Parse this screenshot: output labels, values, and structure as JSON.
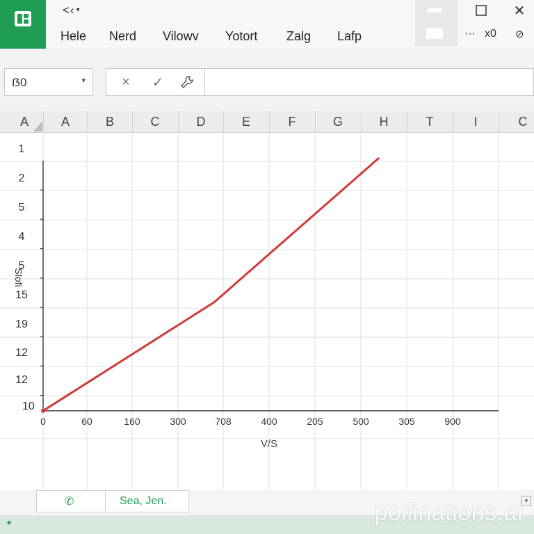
{
  "app": {
    "brand_color": "#1f9d55"
  },
  "quick_access": {
    "text": "<‹",
    "dropdown": "▾"
  },
  "menu": [
    "Hele",
    "Nerd",
    "Vilowv",
    "Yotort",
    "Zalg",
    "Lafp"
  ],
  "window": {
    "more": "···",
    "extra": "x0"
  },
  "formula_bar": {
    "namebox_value": "ẞ0",
    "namebox_dropdown": "▾",
    "cancel_icon": "×",
    "enter_icon": "✓",
    "function_icon": "wrench"
  },
  "columns": [
    "A",
    "A",
    "B",
    "C",
    "D",
    "E",
    "F",
    "G",
    "H",
    "T",
    "I",
    "C"
  ],
  "rows": [
    "1",
    "2",
    "5",
    "4",
    "5",
    "15",
    "19",
    "12",
    "12",
    "10"
  ],
  "chart_data": {
    "type": "line",
    "x_tick_labels": [
      "0",
      "60",
      "160",
      "300",
      "708",
      "400",
      "205",
      "500",
      "305",
      "900"
    ],
    "xlabel": "V/S",
    "ylabel": "Slofi",
    "series": [
      {
        "color": "#d03a3a",
        "points": [
          {
            "x_index": 0,
            "y_row": 10
          },
          {
            "x_index": 3.75,
            "y_row": 6.3
          },
          {
            "x_index": 7.35,
            "y_row": 1.4
          }
        ]
      }
    ],
    "grid": true
  },
  "sheet_tabs": {
    "nav_icon": "phone-icon",
    "nav_glyph": "✆",
    "active": "Sea, Jen."
  },
  "status": {
    "icon": "✦"
  },
  "watermark": "pollinations.ai"
}
